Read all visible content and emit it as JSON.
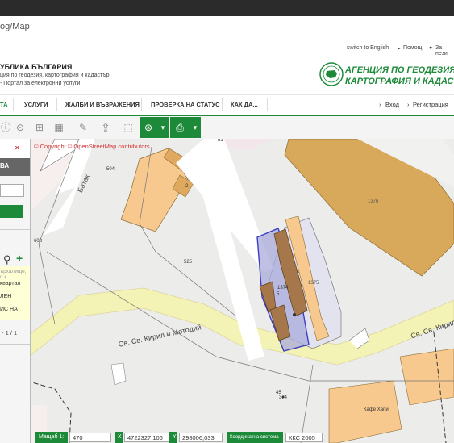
{
  "browser": {
    "url_fragment": "og/Map"
  },
  "header": {
    "switch_lang": "switch to English",
    "help": "Помощ",
    "about": "За нези",
    "title": "УБЛИКА БЪЛГАРИЯ",
    "subtitle_1": "ция по геодезия, картография и кадастър",
    "subtitle_2": "- Портал за електронни услуги",
    "agency_line1": "АГЕНЦИЯ ПО ГЕОДЕЗИЯ,",
    "agency_line2": "КАРТОГРАФИЯ И КАДАСТ"
  },
  "nav": {
    "items": [
      "ТА",
      "УСЛУГИ",
      "ЖАЛБИ И ВЪЗРАЖЕНИЯ",
      "ПРОВЕРКА НА СТАТУС",
      "КАК ДА..."
    ],
    "login": "Вход",
    "register": "Регистрация"
  },
  "sidebar": {
    "tab_label": "ВА",
    "results": [
      "ърхалище, п.к.",
      "квартал",
      "ЛЕН",
      "ИС НА"
    ],
    "pager": "- 1 / 1"
  },
  "map": {
    "copyright": "© Copyright © OpenStreetMap contributors",
    "labels": {
      "batak": "Батак",
      "street_main": "Св. Св. Кирил и Методий",
      "street_right": "Св. Св. Кирил и Методий",
      "n504": "504",
      "n525": "525",
      "n1374": "1374",
      "n1375": "1375",
      "n1376": "1376",
      "n603": "603",
      "n51": "51",
      "n2": "2",
      "n5": "5",
      "n1": "1",
      "n45": "45",
      "n74": "374",
      "shop": "Кафе Хапи"
    }
  },
  "status": {
    "scale_label": "Мащаб 1:",
    "scale_value": "470",
    "x_label": "X",
    "x_value": "4722327,106",
    "y_label": "Y",
    "y_value": "298006,033",
    "crs_label": "Координатна система",
    "crs_value": "ККС 2005"
  }
}
